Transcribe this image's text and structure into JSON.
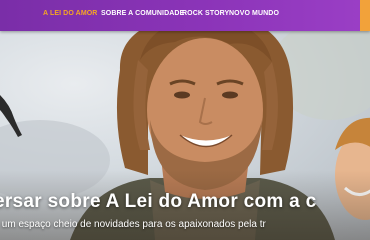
{
  "nav": {
    "items": [
      {
        "label": "A LEI DO AMOR",
        "active": true
      },
      {
        "label": "SOBRE A COMUNIDADE",
        "active": false
      },
      {
        "label": "ROCK STORY",
        "active": false
      },
      {
        "label": "NOVO MUNDO",
        "active": false
      }
    ],
    "active_color": "#f5a623",
    "bar_color": "#8b34b8"
  },
  "hero": {
    "headline": "ersar sobre A Lei do Amor com a c",
    "subline": "s um espaço cheio de novidades para os apaixonados pela tr"
  }
}
